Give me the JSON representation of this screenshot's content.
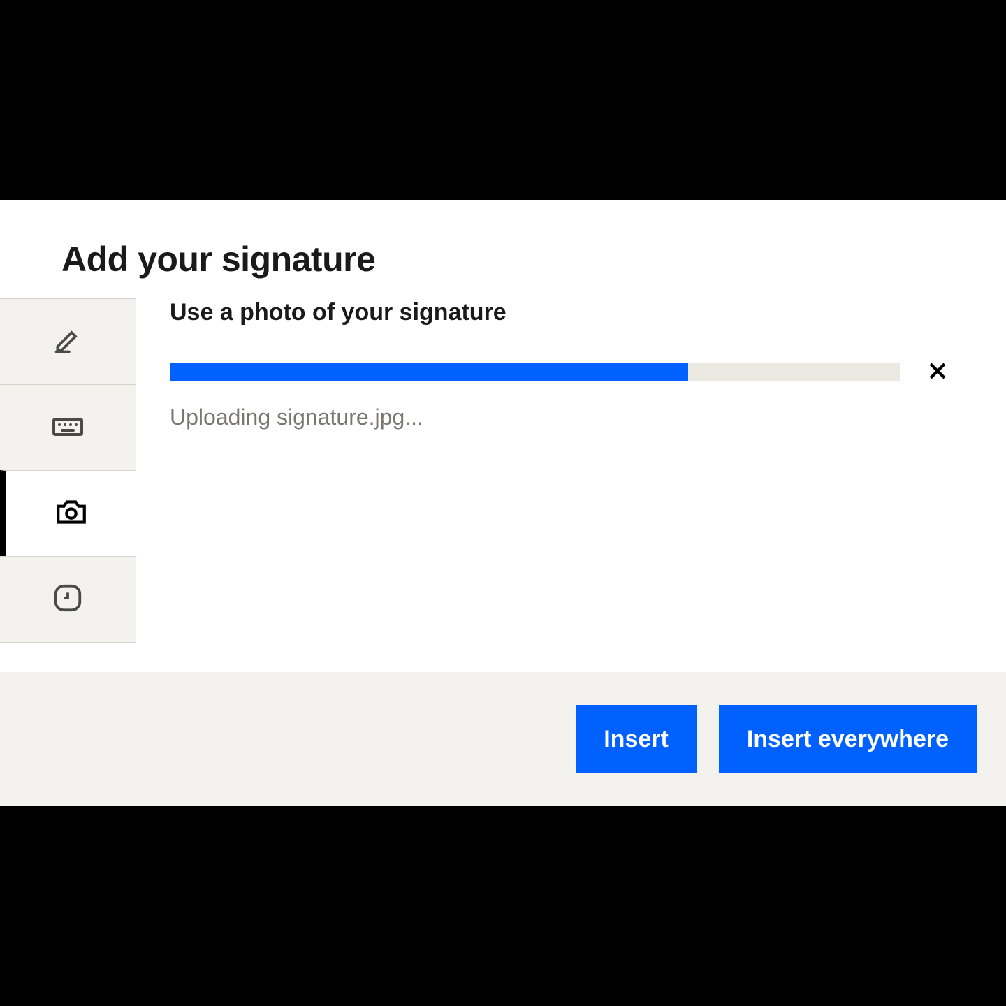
{
  "modal": {
    "title": "Add your signature"
  },
  "tabs": {
    "draw_icon": "pencil",
    "type_icon": "keyboard",
    "photo_icon": "camera",
    "recent_icon": "clock"
  },
  "content": {
    "section_title": "Use a photo of your signature",
    "upload": {
      "progress_percent": 71,
      "status_text": "Uploading signature.jpg..."
    }
  },
  "footer": {
    "insert_label": "Insert",
    "insert_everywhere_label": "Insert everywhere"
  },
  "colors": {
    "accent": "#0061fe",
    "panel": "#f3f2ef",
    "track": "#ece9e2"
  }
}
